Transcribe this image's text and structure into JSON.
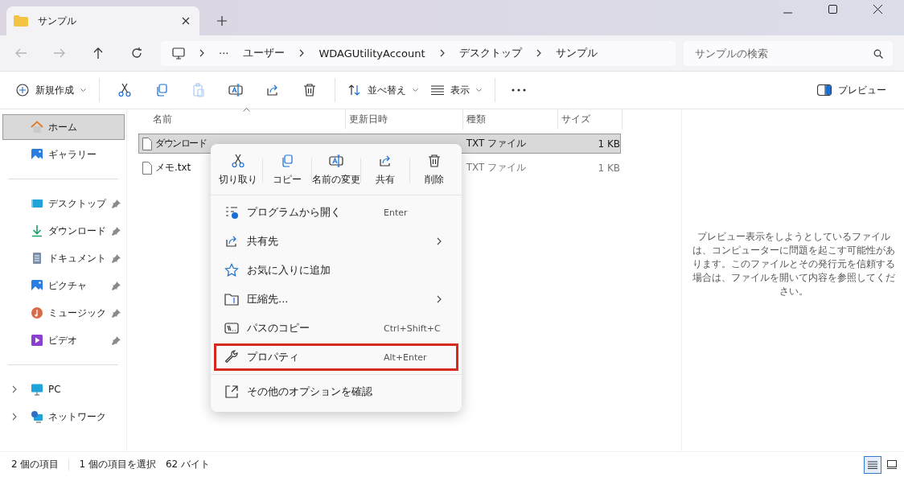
{
  "window": {
    "tab_title": "サンプル"
  },
  "nav_buttons": [
    {
      "disabled": true
    },
    {
      "disabled": true
    },
    {
      "disabled": false
    },
    {
      "disabled": false
    }
  ],
  "address": {
    "overflow": "···",
    "crumbs": [
      "ユーザー",
      "WDAGUtilityAccount",
      "デスクトップ",
      "サンプル"
    ]
  },
  "search": {
    "placeholder": "サンプルの検索"
  },
  "toolbar": {
    "new": "新規作成",
    "actions": [
      {
        "disabled": false
      },
      {
        "disabled": false
      },
      {
        "disabled": true
      },
      {
        "disabled": false
      },
      {
        "disabled": false
      },
      {
        "disabled": false
      }
    ],
    "sort": "並べ替え",
    "view": "表示",
    "preview": "プレビュー"
  },
  "sidebar": {
    "groups": [
      [
        {
          "label": "ホーム",
          "selected": true
        },
        {
          "label": "ギャラリー",
          "selected": false
        }
      ],
      [
        {
          "label": "デスクトップ",
          "selected": false,
          "pinned": true
        },
        {
          "label": "ダウンロード",
          "selected": false,
          "pinned": true
        },
        {
          "label": "ドキュメント",
          "selected": false,
          "pinned": true
        },
        {
          "label": "ピクチャ",
          "selected": false,
          "pinned": true
        },
        {
          "label": "ミュージック",
          "selected": false,
          "pinned": true
        },
        {
          "label": "ビデオ",
          "selected": false,
          "pinned": true
        }
      ],
      [
        {
          "label": "PC",
          "selected": false,
          "expanded": false
        },
        {
          "label": "ネットワーク",
          "selected": false,
          "expanded": false
        }
      ]
    ]
  },
  "columns": [
    "名前",
    "更新日時",
    "種類",
    "サイズ"
  ],
  "files": [
    {
      "name": "ダウンロード",
      "type": "TXT ファイル",
      "size": "1 KB",
      "selected": true
    },
    {
      "name": "メモ.txt",
      "type": "TXT ファイル",
      "size": "1 KB",
      "selected": false
    }
  ],
  "context_menu": {
    "quick_actions": [
      "切り取り",
      "コピー",
      "名前の変更",
      "共有",
      "削除"
    ],
    "items": [
      {
        "label": "プログラムから開く",
        "shortcut": "Enter",
        "submenu": false,
        "highlighted": false
      },
      {
        "label": "共有先",
        "submenu": true,
        "highlighted": false
      },
      {
        "label": "お気に入りに追加",
        "submenu": false,
        "highlighted": false
      },
      {
        "label": "圧縮先...",
        "submenu": true,
        "highlighted": false
      },
      {
        "label": "パスのコピー",
        "shortcut": "Ctrl+Shift+C",
        "submenu": false,
        "highlighted": false
      },
      {
        "label": "プロパティ",
        "shortcut": "Alt+Enter",
        "submenu": false,
        "highlighted": true
      }
    ],
    "more_options": "その他のオプションを確認"
  },
  "preview_message": "プレビュー表示をしようとしているファイルは、コンピューターに問題を起こす可能性があります。このファイルとその発行元を信頼する場合は、ファイルを開いて内容を参照してください。",
  "status": {
    "count": "2 個の項目",
    "selection": "1 個の項目を選択",
    "size": "62 バイト",
    "views": [
      {
        "selected": true
      },
      {
        "selected": false
      }
    ]
  }
}
